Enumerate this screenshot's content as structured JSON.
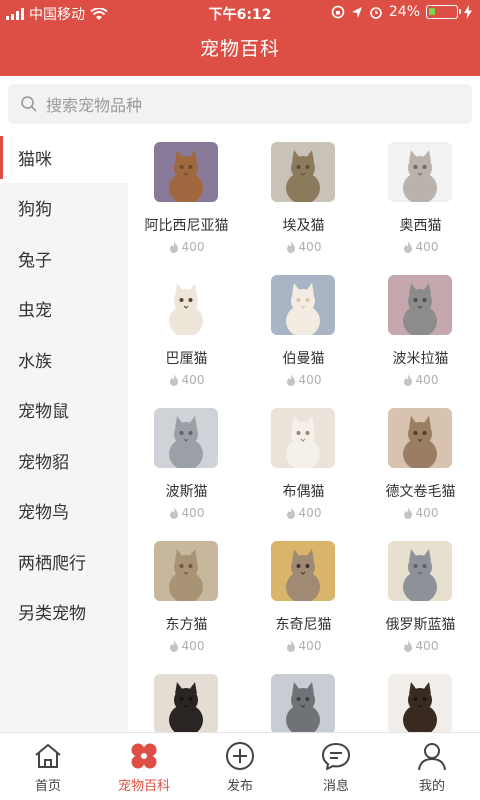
{
  "status": {
    "carrier": "中国移动",
    "time": "下午6:12",
    "battery": "24%",
    "battery_level": 0.24
  },
  "header": {
    "title": "宠物百科"
  },
  "search": {
    "placeholder": "搜索宠物品种"
  },
  "sidebar": {
    "items": [
      {
        "label": "猫咪",
        "active": true
      },
      {
        "label": "狗狗"
      },
      {
        "label": "兔子"
      },
      {
        "label": "虫宠"
      },
      {
        "label": "水族"
      },
      {
        "label": "宠物鼠"
      },
      {
        "label": "宠物貂"
      },
      {
        "label": "宠物鸟"
      },
      {
        "label": "两栖爬行"
      },
      {
        "label": "另类宠物"
      }
    ]
  },
  "breeds": [
    {
      "name": "阿比西尼亚猫",
      "views": "400"
    },
    {
      "name": "埃及猫",
      "views": "400"
    },
    {
      "name": "奥西猫",
      "views": "400"
    },
    {
      "name": "巴厘猫",
      "views": "400"
    },
    {
      "name": "伯曼猫",
      "views": "400"
    },
    {
      "name": "波米拉猫",
      "views": "400"
    },
    {
      "name": "波斯猫",
      "views": "400"
    },
    {
      "name": "布偶猫",
      "views": "400"
    },
    {
      "name": "德文卷毛猫",
      "views": "400"
    },
    {
      "name": "东方猫",
      "views": "400"
    },
    {
      "name": "东奇尼猫",
      "views": "400"
    },
    {
      "name": "俄罗斯蓝猫",
      "views": "400"
    },
    {
      "name": "",
      "views": ""
    },
    {
      "name": "",
      "views": ""
    },
    {
      "name": "",
      "views": ""
    }
  ],
  "tabs": [
    {
      "label": "首页",
      "icon": "home-icon"
    },
    {
      "label": "宠物百科",
      "icon": "encyclopedia-icon",
      "active": true
    },
    {
      "label": "发布",
      "icon": "add-circle-icon"
    },
    {
      "label": "消息",
      "icon": "message-icon"
    },
    {
      "label": "我的",
      "icon": "user-icon"
    }
  ],
  "colors": {
    "accent": "#dd4f44",
    "sidebar_bg": "#f5f5f5"
  }
}
